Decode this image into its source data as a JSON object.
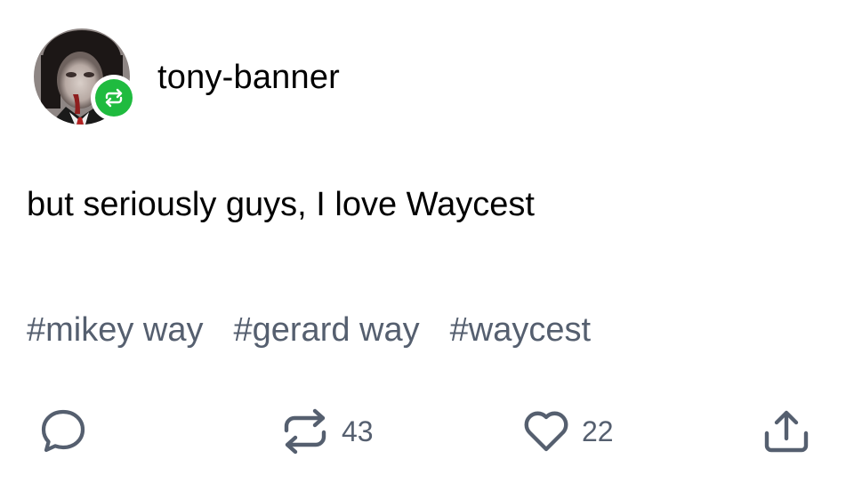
{
  "post": {
    "username": "tony-banner",
    "body": "but seriously guys, I love Waycest",
    "tags": [
      "#mikey way",
      "#gerard way",
      "#waycest"
    ]
  },
  "actions": {
    "reblog_count": "43",
    "like_count": "22"
  },
  "colors": {
    "badge_green": "#1fbb3f",
    "tag_gray": "#555f6f",
    "icon_gray": "#555f6f"
  },
  "icons": {
    "avatar": "avatar",
    "badge": "reblog-icon",
    "reply": "comment-icon",
    "reblog": "reblog-icon",
    "like": "heart-icon",
    "share": "share-icon"
  }
}
